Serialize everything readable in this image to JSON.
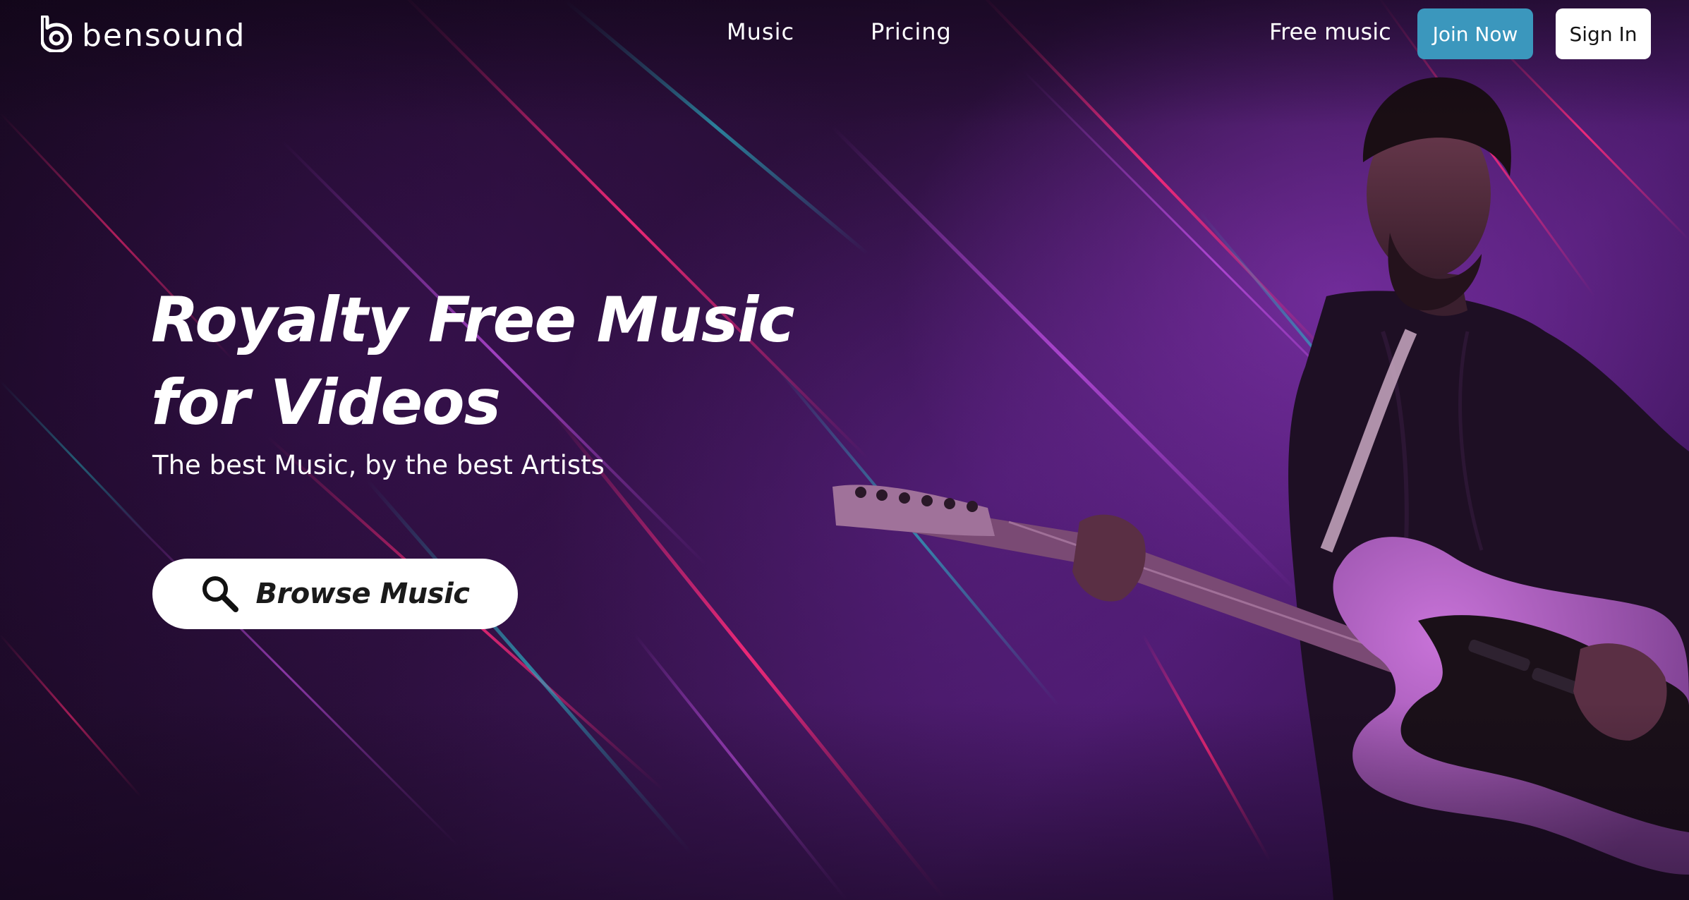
{
  "brand": {
    "name": "bensound",
    "logo_icon": "bensound-b-logo-icon"
  },
  "nav": {
    "links": [
      {
        "label": "Music"
      },
      {
        "label": "Pricing"
      },
      {
        "label": "Free music"
      }
    ],
    "join_label": "Join Now",
    "signin_label": "Sign In"
  },
  "hero": {
    "title_line1": "Royalty Free Music",
    "title_line2": "for Videos",
    "subtitle": "The best Music, by the best Artists",
    "cta_label": "Browse Music",
    "cta_icon": "search-icon"
  },
  "colors": {
    "accent": "#3b97bd",
    "background": "#2a0f3a",
    "streak_pink": "#e0246e",
    "streak_teal": "#2aa7b8",
    "streak_violet": "#b43ed8"
  }
}
